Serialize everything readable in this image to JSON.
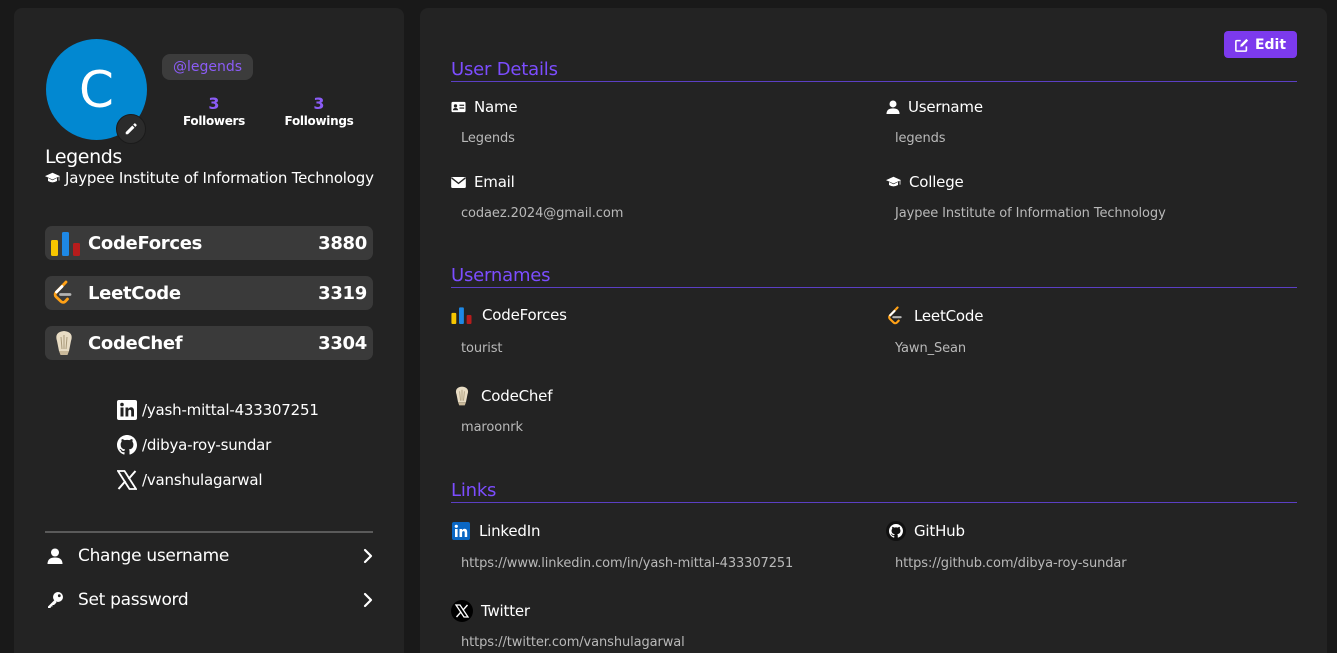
{
  "profile": {
    "avatar_letter": "C",
    "avatar_color": "#0288d1",
    "handle": "@legends",
    "followers": {
      "count": "3",
      "label": "Followers"
    },
    "followings": {
      "count": "3",
      "label": "Followings"
    },
    "name": "Legends",
    "college": "Jaypee Institute of Information Technology"
  },
  "platforms": [
    {
      "name": "CodeForces",
      "score": "3880"
    },
    {
      "name": "LeetCode",
      "score": "3319"
    },
    {
      "name": "CodeChef",
      "score": "3304"
    }
  ],
  "socials": {
    "linkedin": "/yash-mittal-433307251",
    "github": "/dibya-roy-sundar",
    "twitter": "/vanshulagarwal"
  },
  "menu": {
    "change_username": "Change username",
    "set_password": "Set password"
  },
  "edit_label": "Edit",
  "user_details": {
    "title": "User Details",
    "name_label": "Name",
    "name_value": "Legends",
    "username_label": "Username",
    "username_value": "legends",
    "email_label": "Email",
    "email_value": "codaez.2024@gmail.com",
    "college_label": "College",
    "college_value": "Jaypee Institute of Information Technology"
  },
  "usernames": {
    "title": "Usernames",
    "codeforces_label": "CodeForces",
    "codeforces_value": "tourist",
    "leetcode_label": "LeetCode",
    "leetcode_value": "Yawn_Sean",
    "codechef_label": "CodeChef",
    "codechef_value": "maroonrk"
  },
  "links": {
    "title": "Links",
    "linkedin_label": "LinkedIn",
    "linkedin_value": "https://www.linkedin.com/in/yash-mittal-433307251",
    "github_label": "GitHub",
    "github_value": "https://github.com/dibya-roy-sundar",
    "twitter_label": "Twitter",
    "twitter_value": "https://twitter.com/vanshulagarwal"
  },
  "colors": {
    "accent": "#7c3aed",
    "accent_text": "#8b5cf6",
    "section_title": "#7c4dff",
    "panel": "#232323",
    "background": "#191919"
  }
}
